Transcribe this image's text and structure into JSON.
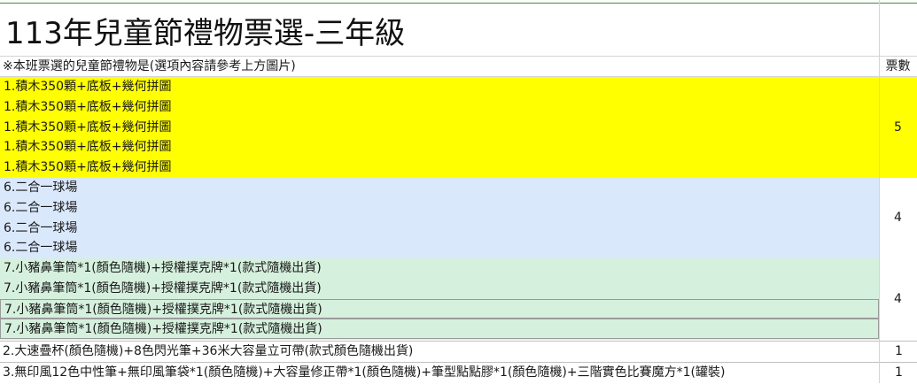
{
  "sheet": {
    "title": "113年兒童節禮物票選-三年級",
    "header": {
      "description": "※本班票選的兒童節禮物是(選項內容請參考上方圖片)",
      "votes_label": "票數"
    },
    "groups": [
      {
        "color": "#ffff00",
        "lines": [
          "1.積木350顆+底板+幾何拼圖",
          "1.積木350顆+底板+幾何拼圖",
          "1.積木350顆+底板+幾何拼圖",
          "1.積木350顆+底板+幾何拼圖",
          "1.積木350顆+底板+幾何拼圖"
        ],
        "votes": "5"
      },
      {
        "color": "#dae8fc",
        "lines": [
          "6.二合一球場",
          "6.二合一球場",
          "6.二合一球場",
          "6.二合一球場"
        ],
        "votes": "4"
      },
      {
        "color": "#d5f0dd",
        "lines": [
          "7.小豬鼻筆筒*1(顏色隨機)+授權撲克牌*1(款式隨機出貨)",
          "7.小豬鼻筆筒*1(顏色隨機)+授權撲克牌*1(款式隨機出貨)",
          "7.小豬鼻筆筒*1(顏色隨機)+授權撲克牌*1(款式隨機出貨)",
          "7.小豬鼻筆筒*1(顏色隨機)+授權撲克牌*1(款式隨機出貨)"
        ],
        "votes": "4"
      }
    ],
    "rows": [
      {
        "text": "2.大速疊杯(顏色隨機)+8色閃光筆+36米大容量立可帶(款式顏色隨機出貨)",
        "votes": "1"
      },
      {
        "text": "3.無印風12色中性筆+無印風筆袋*1(顏色隨機)+大容量修正帶*1(顏色隨機)+筆型點點膠*1(顏色隨機)+三階實色比賽魔方*1(罐裝)",
        "votes": "1"
      }
    ]
  }
}
